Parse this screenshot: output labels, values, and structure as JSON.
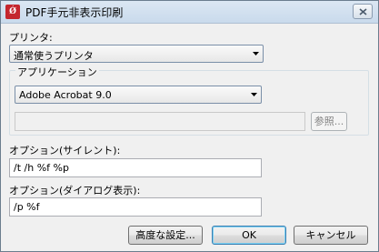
{
  "window": {
    "title": "PDF手元非表示印刷",
    "app_icon_text": "Ǿ"
  },
  "printer": {
    "label": "プリンタ:",
    "selected": "通常使うプリンタ"
  },
  "application": {
    "group_label": "アプリケーション",
    "selected": "Adobe Acrobat 9.0",
    "path_value": "",
    "browse_label": "参照..."
  },
  "silent_option": {
    "label": "オプション(サイレント):",
    "value": "/t /h %f %p"
  },
  "dialog_option": {
    "label": "オプション(ダイアログ表示):",
    "value": "/p %f"
  },
  "buttons": {
    "advanced": "高度な設定...",
    "ok": "OK",
    "cancel": "キャンセル"
  }
}
